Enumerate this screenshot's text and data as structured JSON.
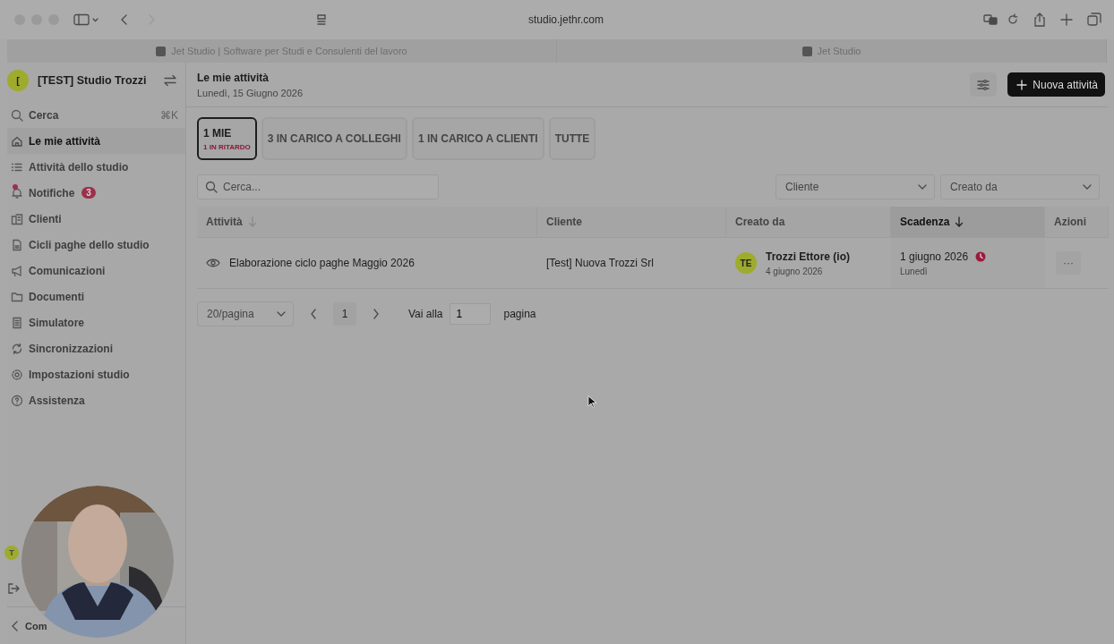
{
  "browser": {
    "url": "studio.jethr.com",
    "tabs": [
      {
        "title": "Jet Studio | Software per Studi e Consulenti del lavoro"
      },
      {
        "title": "Jet Studio"
      }
    ]
  },
  "sidebar": {
    "org": {
      "initial": "[",
      "name": "[TEST] Studio Trozzi"
    },
    "search": {
      "label": "Cerca",
      "shortcut": "⌘K"
    },
    "items": [
      {
        "label": "Le mie attività",
        "selected": true
      },
      {
        "label": "Attività dello studio",
        "selected": false
      },
      {
        "label": "Notifiche",
        "selected": false,
        "badge": "3",
        "alert": true
      },
      {
        "label": "Clienti",
        "selected": false
      },
      {
        "label": "Cicli paghe dello studio",
        "selected": false
      },
      {
        "label": "Comunicazioni",
        "selected": false
      },
      {
        "label": "Documenti",
        "selected": false
      },
      {
        "label": "Simulatore",
        "selected": false
      },
      {
        "label": "Sincronizzazioni",
        "selected": false
      },
      {
        "label": "Impostazioni studio",
        "selected": false
      },
      {
        "label": "Assistenza",
        "selected": false
      }
    ],
    "user_initial": "T",
    "footer": "Com"
  },
  "header": {
    "title": "Le mie attività",
    "date": "Lunedì, 15 Giugno 2026",
    "new_button": "Nuova attività"
  },
  "tabs": [
    {
      "label": "1 MIE",
      "sub": "1 IN RITARDO",
      "selected": true
    },
    {
      "label": "3 IN CARICO A COLLEGHI",
      "selected": false
    },
    {
      "label": "1 IN CARICO A CLIENTI",
      "selected": false
    },
    {
      "label": "TUTTE",
      "selected": false
    }
  ],
  "filters": {
    "search_placeholder": "Cerca...",
    "selects": [
      "Cliente",
      "Creato da"
    ]
  },
  "table": {
    "columns": [
      {
        "label": "Attività",
        "sortable": true,
        "sorted": false
      },
      {
        "label": "Cliente",
        "sortable": false,
        "sorted": false
      },
      {
        "label": "Creato da",
        "sortable": false,
        "sorted": false
      },
      {
        "label": "Scadenza",
        "sortable": true,
        "sorted": true
      },
      {
        "label": "Azioni",
        "sortable": false,
        "sorted": false
      }
    ],
    "rows": [
      {
        "activity": "Elaborazione ciclo paghe Maggio 2026",
        "client": "[Test] Nuova Trozzi Srl",
        "creator_initials": "TE",
        "creator": "Trozzi Ettore (io)",
        "created": "4 giugno 2026",
        "due": "1 giugno 2026",
        "due_day": "Lunedì",
        "overdue": true,
        "actions": "···"
      }
    ]
  },
  "pagination": {
    "page_size": "20/pagina",
    "page": "1",
    "goto_label": "Vai alla",
    "goto_value": "1",
    "goto_suffix": "pagina"
  }
}
